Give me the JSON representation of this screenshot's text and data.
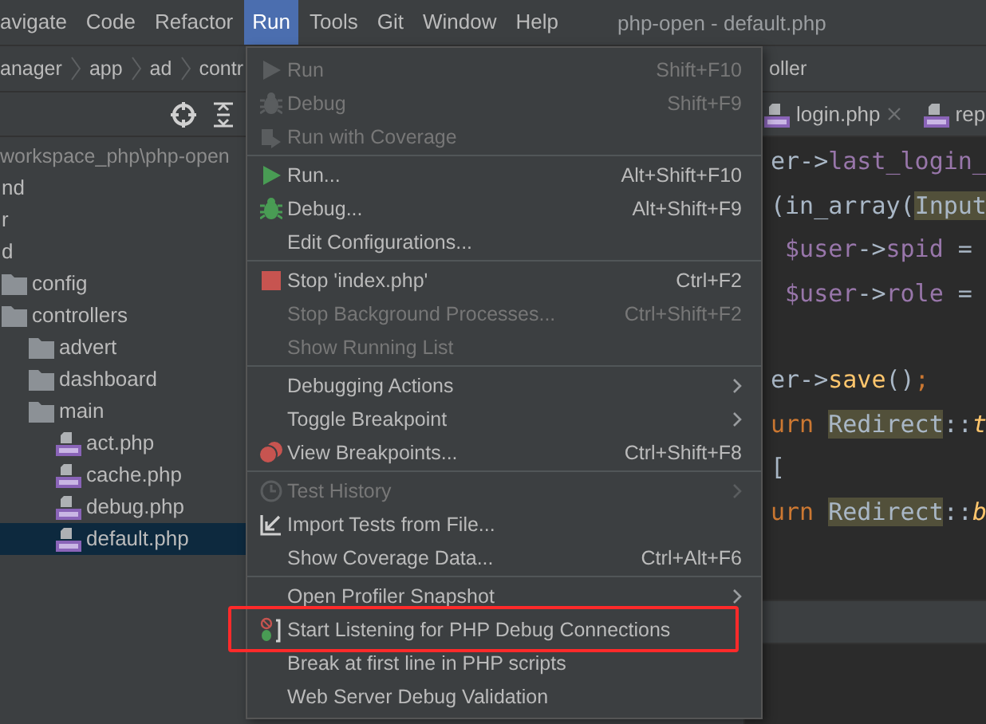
{
  "menubar": {
    "items": [
      {
        "label": "avigate",
        "selected": false
      },
      {
        "label": "Code",
        "selected": false
      },
      {
        "label": "Refactor",
        "selected": false
      },
      {
        "label": "Run",
        "selected": true
      },
      {
        "label": "Tools",
        "selected": false
      },
      {
        "label": "Git",
        "selected": false
      },
      {
        "label": "Window",
        "selected": false
      },
      {
        "label": "Help",
        "selected": false
      }
    ],
    "title": "php-open - default.php"
  },
  "breadcrumb": {
    "items": [
      "anager",
      "app",
      "ad",
      "contr"
    ],
    "tail": "oller"
  },
  "project_tree": {
    "root_path": "workspace_php\\php-open",
    "items": [
      {
        "name": "nd",
        "kind": "label",
        "selected": false
      },
      {
        "name": "r",
        "kind": "label",
        "selected": false
      },
      {
        "name": "d",
        "kind": "label",
        "selected": false
      },
      {
        "name": "config",
        "kind": "folder",
        "selected": false
      },
      {
        "name": "controllers",
        "kind": "folder",
        "selected": false,
        "children": [
          {
            "name": "advert",
            "kind": "folder",
            "selected": false
          },
          {
            "name": "dashboard",
            "kind": "folder",
            "selected": false
          },
          {
            "name": "main",
            "kind": "folder",
            "selected": false,
            "children": [
              {
                "name": "act.php",
                "kind": "php",
                "selected": false
              },
              {
                "name": "cache.php",
                "kind": "php",
                "selected": false
              },
              {
                "name": "debug.php",
                "kind": "php",
                "selected": false
              },
              {
                "name": "default.php",
                "kind": "php",
                "selected": true
              }
            ]
          }
        ]
      }
    ]
  },
  "editor": {
    "tabs": [
      {
        "label": "login.php",
        "closable": true
      },
      {
        "label": "rep",
        "closable": false
      }
    ],
    "lines": [
      {
        "kind": "code",
        "tokens": [
          {
            "t": "er->",
            "kind": "plain"
          },
          {
            "t": "last_login_",
            "kind": "field"
          }
        ]
      },
      {
        "kind": "code",
        "tokens": [
          {
            "t": "(in_array(",
            "kind": "plain"
          },
          {
            "t": "Input",
            "kind": "match"
          }
        ]
      },
      {
        "kind": "code",
        "tokens": [
          {
            "t": " $user",
            "kind": "field"
          },
          {
            "t": "->",
            "kind": "plain"
          },
          {
            "t": "spid",
            "kind": "field"
          },
          {
            "t": " =",
            "kind": "plain"
          }
        ]
      },
      {
        "kind": "code",
        "tokens": [
          {
            "t": " $user",
            "kind": "field"
          },
          {
            "t": "->",
            "kind": "plain"
          },
          {
            "t": "role",
            "kind": "field"
          },
          {
            "t": " =",
            "kind": "plain"
          }
        ]
      },
      {
        "kind": "blank"
      },
      {
        "kind": "code",
        "tokens": [
          {
            "t": "er->",
            "kind": "plain"
          },
          {
            "t": "save",
            "kind": "method"
          },
          {
            "t": "()",
            "kind": "plain"
          },
          {
            "t": ";",
            "kind": "keyword"
          }
        ]
      },
      {
        "kind": "code",
        "tokens": [
          {
            "t": "urn ",
            "kind": "keyword"
          },
          {
            "t": "Redirect",
            "kind": "match"
          },
          {
            "t": "::",
            "kind": "plain"
          },
          {
            "t": "t",
            "kind": "static"
          }
        ]
      },
      {
        "kind": "code",
        "tokens": [
          {
            "t": "[",
            "kind": "plain"
          }
        ]
      },
      {
        "kind": "code",
        "tokens": [
          {
            "t": "urn ",
            "kind": "keyword"
          },
          {
            "t": "Redirect",
            "kind": "match"
          },
          {
            "t": "::",
            "kind": "plain"
          },
          {
            "t": "b",
            "kind": "static"
          }
        ]
      }
    ]
  },
  "run_menu": {
    "groups": [
      {
        "items": [
          {
            "label": "Run",
            "shortcut": "Shift+F10",
            "kind": "run",
            "disabled": true
          },
          {
            "label": "Debug",
            "shortcut": "Shift+F9",
            "kind": "debug",
            "disabled": true
          },
          {
            "label": "Run with Coverage",
            "kind": "coverage",
            "disabled": true
          }
        ]
      },
      {
        "items": [
          {
            "label": "Run...",
            "shortcut": "Alt+Shift+F10",
            "kind": "run",
            "disabled": false
          },
          {
            "label": "Debug...",
            "shortcut": "Alt+Shift+F9",
            "kind": "debug",
            "disabled": false
          },
          {
            "label": "Edit Configurations...",
            "kind": "plain",
            "disabled": false
          }
        ]
      },
      {
        "items": [
          {
            "label": "Stop 'index.php'",
            "shortcut": "Ctrl+F2",
            "kind": "stop",
            "disabled": false
          },
          {
            "label": "Stop Background Processes...",
            "shortcut": "Ctrl+Shift+F2",
            "kind": "plain",
            "disabled": true
          },
          {
            "label": "Show Running List",
            "kind": "plain",
            "disabled": true
          }
        ]
      },
      {
        "items": [
          {
            "label": "Debugging Actions",
            "kind": "plain",
            "disabled": false,
            "submenu": true
          },
          {
            "label": "Toggle Breakpoint",
            "kind": "plain",
            "disabled": false,
            "submenu": true
          },
          {
            "label": "View Breakpoints...",
            "shortcut": "Ctrl+Shift+F8",
            "kind": "breakpoints",
            "disabled": false
          }
        ]
      },
      {
        "items": [
          {
            "label": "Test History",
            "kind": "history",
            "disabled": true,
            "submenu": true
          },
          {
            "label": "Import Tests from File...",
            "kind": "import",
            "disabled": false
          },
          {
            "label": "Show Coverage Data...",
            "shortcut": "Ctrl+Alt+F6",
            "kind": "plain",
            "disabled": false
          }
        ]
      },
      {
        "items": [
          {
            "label": "Open Profiler Snapshot",
            "kind": "plain",
            "disabled": false,
            "submenu": true
          },
          {
            "label": "Start Listening for PHP Debug Connections",
            "kind": "listen",
            "disabled": false,
            "highlighted": true
          },
          {
            "label": "Break at first line in PHP scripts",
            "kind": "plain",
            "disabled": false
          },
          {
            "label": "Web Server Debug Validation",
            "kind": "plain",
            "disabled": false
          }
        ]
      }
    ]
  }
}
